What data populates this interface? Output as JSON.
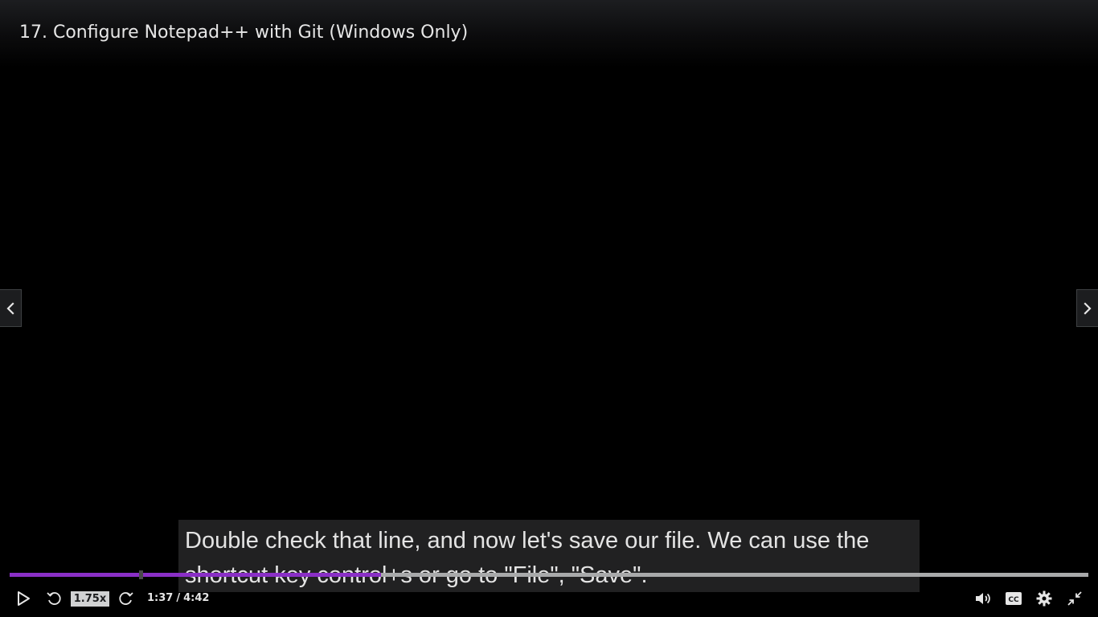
{
  "video": {
    "title": "17. Configure Notepad++ with Git (Windows Only)"
  },
  "navigation": {
    "prev_icon": "chevron-left-icon",
    "next_icon": "chevron-right-icon"
  },
  "caption": {
    "lines": [
      "Double check that line, and now let's save our file. We can use the",
      "shortcut key control+s or go to \"File\", \"Save\"."
    ]
  },
  "progress": {
    "played_fraction": 0.344,
    "buffered_fraction": 1.0,
    "marker_fraction": 0.12,
    "played_color": "#8a2fc6",
    "track_color": "#a8a9aa"
  },
  "controls": {
    "play_icon": "play-icon",
    "rewind_icon": "rewind-5-icon",
    "speed_label": "1.75x",
    "forward_icon": "forward-5-icon",
    "current_time": "1:37",
    "separator": "/",
    "duration": "4:42",
    "volume_icon": "volume-icon",
    "captions_icon": "closed-captions-icon",
    "captions_label": "CC",
    "settings_icon": "gear-icon",
    "exit_fullscreen_icon": "exit-fullscreen-icon"
  }
}
